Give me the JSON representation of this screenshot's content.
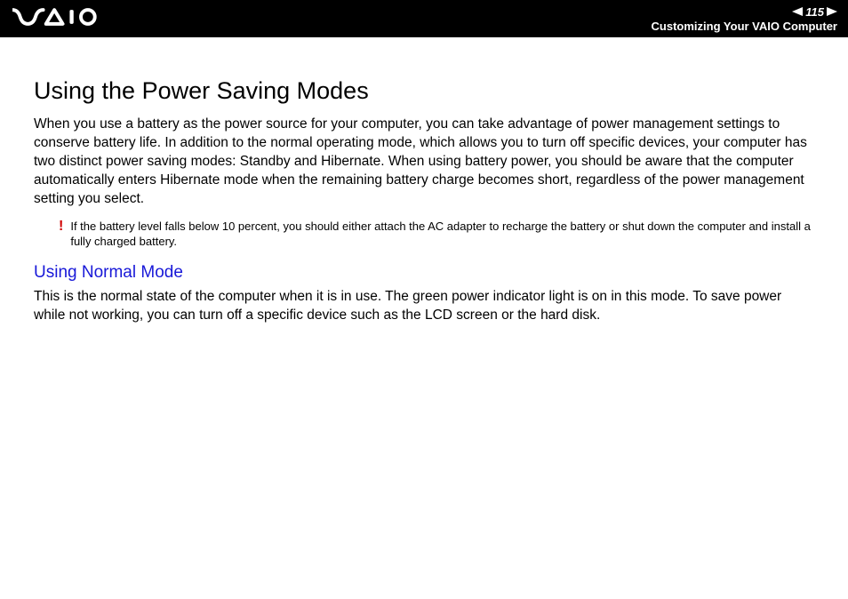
{
  "header": {
    "page_number": "115",
    "section": "Customizing Your VAIO Computer"
  },
  "content": {
    "heading": "Using the Power Saving Modes",
    "intro": "When you use a battery as the power source for your computer, you can take advantage of power management settings to conserve battery life. In addition to the normal operating mode, which allows you to turn off specific devices, your computer has two distinct power saving modes: Standby and Hibernate. When using battery power, you should be aware that the computer automatically enters Hibernate mode when the remaining battery charge becomes short, regardless of the power management setting you select.",
    "warning_mark": "!",
    "warning_text": "If the battery level falls below 10 percent, you should either attach the AC adapter to recharge the battery or shut down the computer and install a fully charged battery.",
    "subheading": "Using Normal Mode",
    "subtext": "This is the normal state of the computer when it is in use. The green power indicator light is on in this mode. To save power while not working, you can turn off a specific device such as the LCD screen or the hard disk."
  }
}
